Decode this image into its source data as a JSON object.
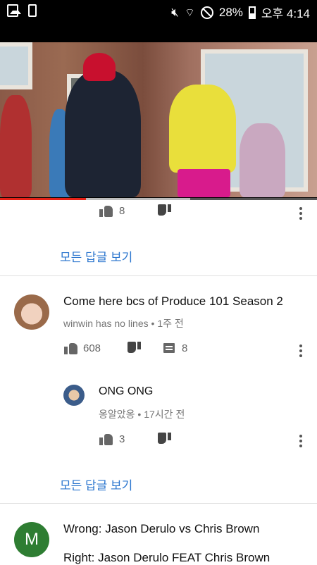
{
  "status_bar": {
    "battery": "28%",
    "time": "오후 4:14",
    "icons": [
      "gallery-icon",
      "phone-icon",
      "mute-icon",
      "wifi-icon",
      "blocked-icon",
      "battery-icon"
    ]
  },
  "video": {
    "progress_percent": 27,
    "buffered_percent": 60
  },
  "reply_top": {
    "like_count": "8",
    "view_all_replies": "모든 답글 보기"
  },
  "comment_1": {
    "text": "Come here bcs of Produce 101 Season 2",
    "author": "winwin has no lines",
    "time": "1주 전",
    "like_count": "608",
    "reply_count": "8"
  },
  "reply_1": {
    "text": "ONG ONG",
    "author": "옹알았옹",
    "time": "17시간 전",
    "like_count": "3",
    "view_all_replies": "모든 답글 보기"
  },
  "comment_2": {
    "avatar_letter": "M",
    "avatar_color": "#2e7d32",
    "line1": "Wrong:  Jason Derulo vs Chris Brown",
    "line2": "Right: Jason Derulo FEAT Chris Brown"
  },
  "colors": {
    "link_blue": "#2d77cf",
    "progress_red": "#e62117"
  }
}
